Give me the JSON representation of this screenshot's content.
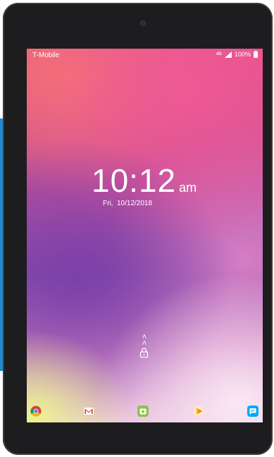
{
  "status_bar": {
    "carrier": "T-Mobile",
    "signal_badge": "4G",
    "battery_percent": "100%"
  },
  "lock_screen": {
    "time": "10:12",
    "ampm": "am",
    "date": "Fri,  10/12/2018"
  },
  "dock": {
    "apps": [
      {
        "name": "Chrome",
        "icon": "chrome-icon"
      },
      {
        "name": "Gmail",
        "icon": "gmail-icon"
      },
      {
        "name": "Camera",
        "icon": "camera-icon"
      },
      {
        "name": "Play Music",
        "icon": "play-music-icon"
      },
      {
        "name": "Messages",
        "icon": "messages-icon"
      }
    ]
  },
  "colors": {
    "accent_tab": "#1e8bd1",
    "device_frame": "#1d1d1f"
  }
}
